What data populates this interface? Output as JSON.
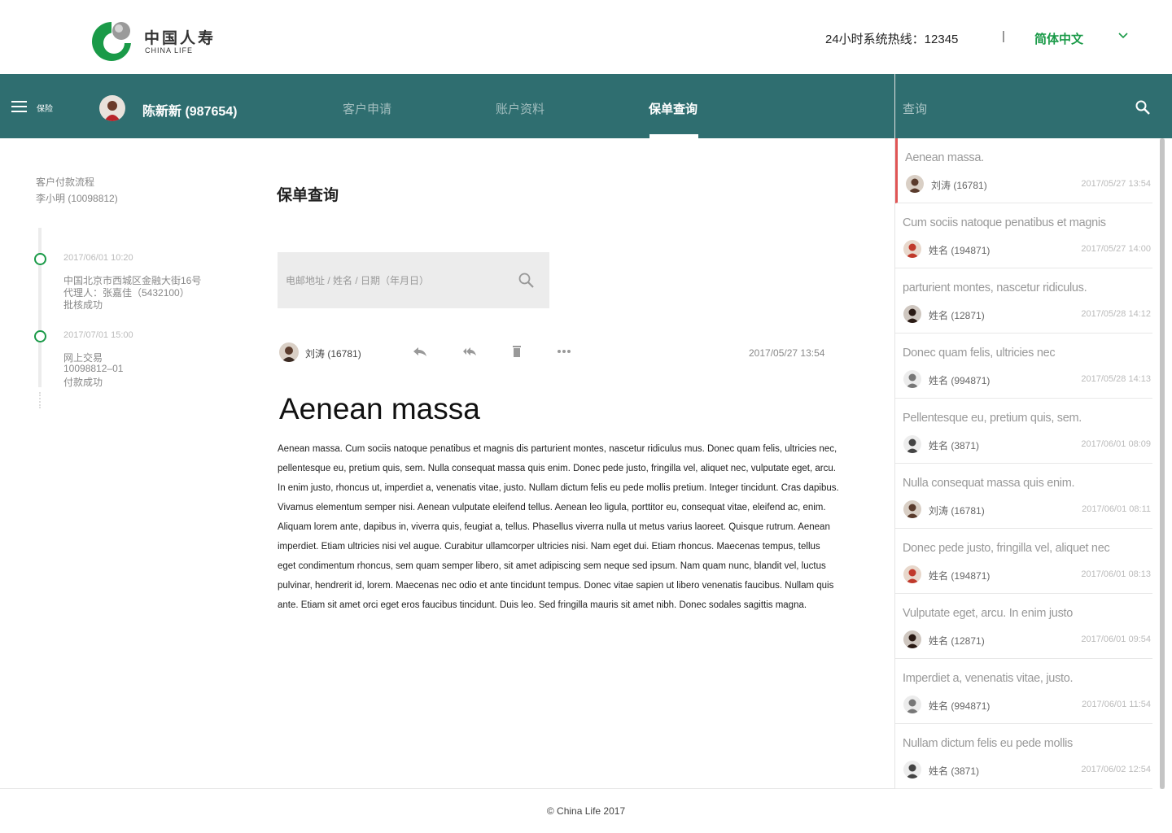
{
  "header": {
    "logo_cn": "中国人寿",
    "logo_en": "CHINA LIFE",
    "hotline": "24小时系统热线：12345",
    "separator": "|",
    "language": "简体中文",
    "brand_green": "#1a9a48"
  },
  "nav": {
    "menu_label": "保险",
    "user_name": "陈新新 (987654)",
    "tabs": [
      {
        "label": "客户申请",
        "active": false
      },
      {
        "label": "账户资料",
        "active": false
      },
      {
        "label": "保单查询",
        "active": true
      }
    ],
    "bg_color": "#2f6e70"
  },
  "search_panel": {
    "label": "查询"
  },
  "left": {
    "title": "客户付款流程",
    "subtitle": "李小明 (10098812)",
    "timeline": [
      {
        "date": "2017/06/01   10:20",
        "lines": [
          "中国北京市西城区金融大街16号",
          "代理人：张嘉佳（5432100）",
          "批核成功"
        ]
      },
      {
        "date": "2017/07/01   15:00",
        "lines": [
          "网上交易",
          "10098812–01",
          "付款成功"
        ]
      }
    ]
  },
  "main": {
    "title": "保单查询",
    "search_placeholder": "电邮地址 / 姓名 / 日期（年月日）",
    "message": {
      "sender": "刘涛 (16781)",
      "date": "2017/05/27   13:54",
      "heading": "Aenean massa",
      "body": "Aenean massa. Cum sociis natoque penatibus et magnis dis parturient montes, nascetur ridiculus mus. Donec quam felis, ultricies nec, pellentesque eu, pretium quis, sem. Nulla consequat massa quis enim. Donec pede justo, fringilla vel, aliquet nec, vulputate eget, arcu. In enim justo, rhoncus ut, imperdiet a, venenatis vitae, justo. Nullam dictum felis eu pede mollis pretium. Integer tincidunt. Cras dapibus. Vivamus elementum semper nisi. Aenean vulputate eleifend tellus. Aenean leo ligula, porttitor eu, consequat vitae, eleifend ac, enim. Aliquam lorem ante, dapibus in, viverra quis, feugiat a, tellus. Phasellus viverra nulla ut metus varius laoreet. Quisque rutrum. Aenean imperdiet. Etiam ultricies nisi vel augue. Curabitur ullamcorper ultricies nisi. Nam eget dui. Etiam rhoncus. Maecenas tempus, tellus eget condimentum rhoncus, sem quam semper libero, sit amet adipiscing sem neque sed ipsum. Nam quam nunc, blandit vel, luctus pulvinar, hendrerit id, lorem. Maecenas nec odio et ante tincidunt tempus. Donec vitae sapien ut libero venenatis faucibus. Nullam quis ante. Etiam sit amet orci eget eros faucibus tincidunt. Duis leo. Sed fringilla mauris sit amet nibh. Donec sodales sagittis magna."
    },
    "toolbar_icons": [
      "reply-icon",
      "reply-all-icon",
      "trash-icon",
      "more-icon"
    ]
  },
  "list": [
    {
      "title": "Aenean massa.",
      "user": "刘涛 (16781)",
      "date": "2017/05/27   13:54",
      "active": true
    },
    {
      "title": "Cum sociis natoque penatibus et magnis",
      "user": "姓名 (194871)",
      "date": "2017/05/27   14:00",
      "active": false
    },
    {
      "title": "parturient montes, nascetur ridiculus.",
      "user": "姓名 (12871)",
      "date": "2017/05/28   14:12",
      "active": false
    },
    {
      "title": "Donec quam felis, ultricies nec",
      "user": "姓名 (994871)",
      "date": "2017/05/28   14:13",
      "active": false
    },
    {
      "title": "Pellentesque eu, pretium quis, sem.",
      "user": "姓名 (3871)",
      "date": "2017/06/01   08:09",
      "active": false
    },
    {
      "title": "Nulla consequat massa quis enim.",
      "user": "刘涛 (16781)",
      "date": "2017/06/01   08:11",
      "active": false
    },
    {
      "title": "Donec pede justo, fringilla vel, aliquet nec",
      "user": "姓名 (194871)",
      "date": "2017/06/01   08:13",
      "active": false
    },
    {
      "title": "Vulputate eget, arcu. In enim justo",
      "user": "姓名 (12871)",
      "date": "2017/06/01   09:54",
      "active": false
    },
    {
      "title": "Imperdiet a, venenatis vitae, justo.",
      "user": "姓名 (994871)",
      "date": "2017/06/01   11:54",
      "active": false
    },
    {
      "title": "Nullam dictum felis eu pede mollis",
      "user": "姓名 (3871)",
      "date": "2017/06/02   12:54",
      "active": false
    }
  ],
  "footer": "© China Life 2017"
}
